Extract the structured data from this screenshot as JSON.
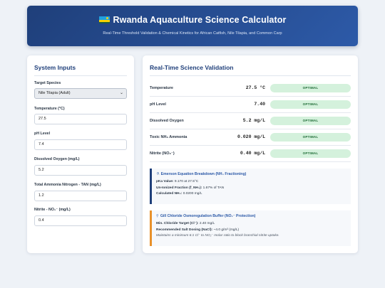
{
  "header": {
    "title": "Rwanda Aquaculture Science Calculator",
    "subtitle": "Real-Time Threshold Validation & Chemical Kinetics for African Catfish, Nile Tilapia, and Common Carp"
  },
  "inputs": {
    "heading": "System Inputs",
    "species_label": "Target Species",
    "species_value": "Nile Tilapia (Adult)",
    "temperature_label": "Temperature (°C)",
    "temperature_value": "27.5",
    "ph_label": "pH Level",
    "ph_value": "7.4",
    "do_label": "Dissolved Oxygen (mg/L)",
    "do_value": "5.2",
    "tan_label": "Total Ammonia Nitrogen - TAN (mg/L)",
    "tan_value": "1.2",
    "nitrite_label": "Nitrite - NO₂⁻ (mg/L)",
    "nitrite_value": "0.4"
  },
  "validation": {
    "heading": "Real-Time Science Validation",
    "rows": [
      {
        "param": "Temperature",
        "value": "27.5 °C",
        "status": "OPTIMAL"
      },
      {
        "param": "pH Level",
        "value": "7.40",
        "status": "OPTIMAL"
      },
      {
        "param": "Dissolved Oxygen",
        "value": "5.2 mg/L",
        "status": "OPTIMAL"
      },
      {
        "param": "Toxic NH₃ Ammonia",
        "value": "0.020 mg/L",
        "status": "OPTIMAL"
      },
      {
        "param": "Nitrite (NO₂⁻)",
        "value": "0.40 mg/L",
        "status": "OPTIMAL"
      }
    ],
    "status_color": "#d4f1dc"
  },
  "emerson": {
    "icon": "flask-icon",
    "title": "Emerson Equation Breakdown (NH₃ Fractioning)",
    "pka_label": "pKa Value:",
    "pka_value": "9.170 at 27.5°C",
    "fraction_label": "Un-Ionized Fraction (f_NH₃):",
    "fraction_value": "1.67% of TAN",
    "calc_label": "Calculated NH₃:",
    "calc_value": "0.0200 mg/L"
  },
  "gill": {
    "icon": "pin-icon",
    "title": "Gill Chloride Osmoregulation Buffer (NO₂⁻ Protection)",
    "target_label": "Min. Chloride Target (Cl⁻):",
    "target_value": "2.40 mg/L",
    "dosing_label": "Recommended Salt Dosing (NaCl):",
    "dosing_value": "~4.0 g/m³ (mg/L)",
    "note": "Maintains a minimum 6:1 Cl⁻ to NO₂⁻ molar ratio to block branchial nitrite uptake."
  }
}
